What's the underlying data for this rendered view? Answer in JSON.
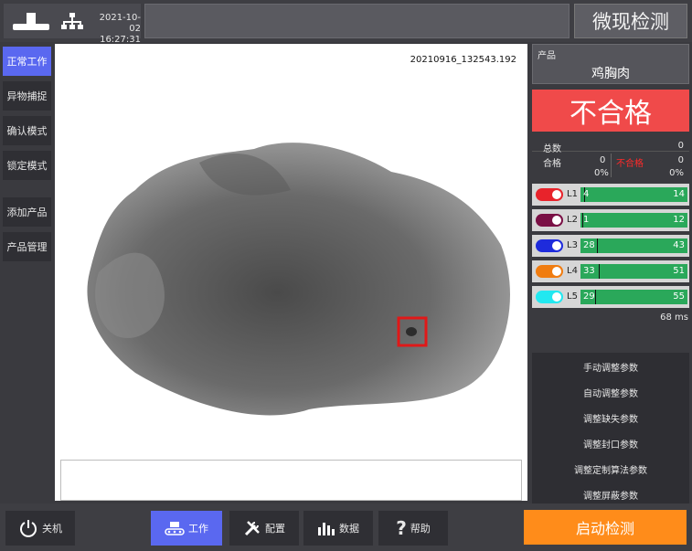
{
  "top": {
    "date": "2021-10-02",
    "time": "16:27:31",
    "title": "微现检测"
  },
  "nav": {
    "items": [
      {
        "label": "正常工作",
        "active": true
      },
      {
        "label": "异物捕捉"
      },
      {
        "label": "确认模式"
      },
      {
        "label": "锁定模式"
      },
      {
        "label": "添加产品"
      },
      {
        "label": "产品管理"
      }
    ]
  },
  "viewer": {
    "timestamp": "20210916_132543.192"
  },
  "product": {
    "label": "产品",
    "name": "鸡胸肉"
  },
  "verdict": "不合格",
  "stats": {
    "total_label": "总数",
    "total": "0",
    "pass_label": "合格",
    "pass_count": "0",
    "fail_label": "不合格",
    "fail_count": "0",
    "pass_pct": "0%",
    "fail_pct": "0%"
  },
  "lanes": [
    {
      "name": "L1",
      "low": "4",
      "high": "14",
      "color": "#e8232b",
      "marker_fraction": 0.03
    },
    {
      "name": "L2",
      "low": "1",
      "high": "12",
      "color": "#7a1045",
      "marker_fraction": 0.02
    },
    {
      "name": "L3",
      "low": "28",
      "high": "43",
      "color": "#1e2bdc",
      "marker_fraction": 0.15
    },
    {
      "name": "L4",
      "low": "33",
      "high": "51",
      "color": "#f07c10",
      "marker_fraction": 0.17
    },
    {
      "name": "L5",
      "low": "29",
      "high": "55",
      "color": "#22e8f0",
      "marker_fraction": 0.14
    }
  ],
  "timing": "68 ms",
  "params": [
    "手动调整参数",
    "自动调整参数",
    "调整缺失参数",
    "调整封口参数",
    "调整定制算法参数",
    "调整屏蔽参数"
  ],
  "bottom": {
    "shutdown": "关机",
    "work": "工作",
    "config": "配置",
    "data": "数据",
    "help": "帮助",
    "start": "启动检测"
  }
}
